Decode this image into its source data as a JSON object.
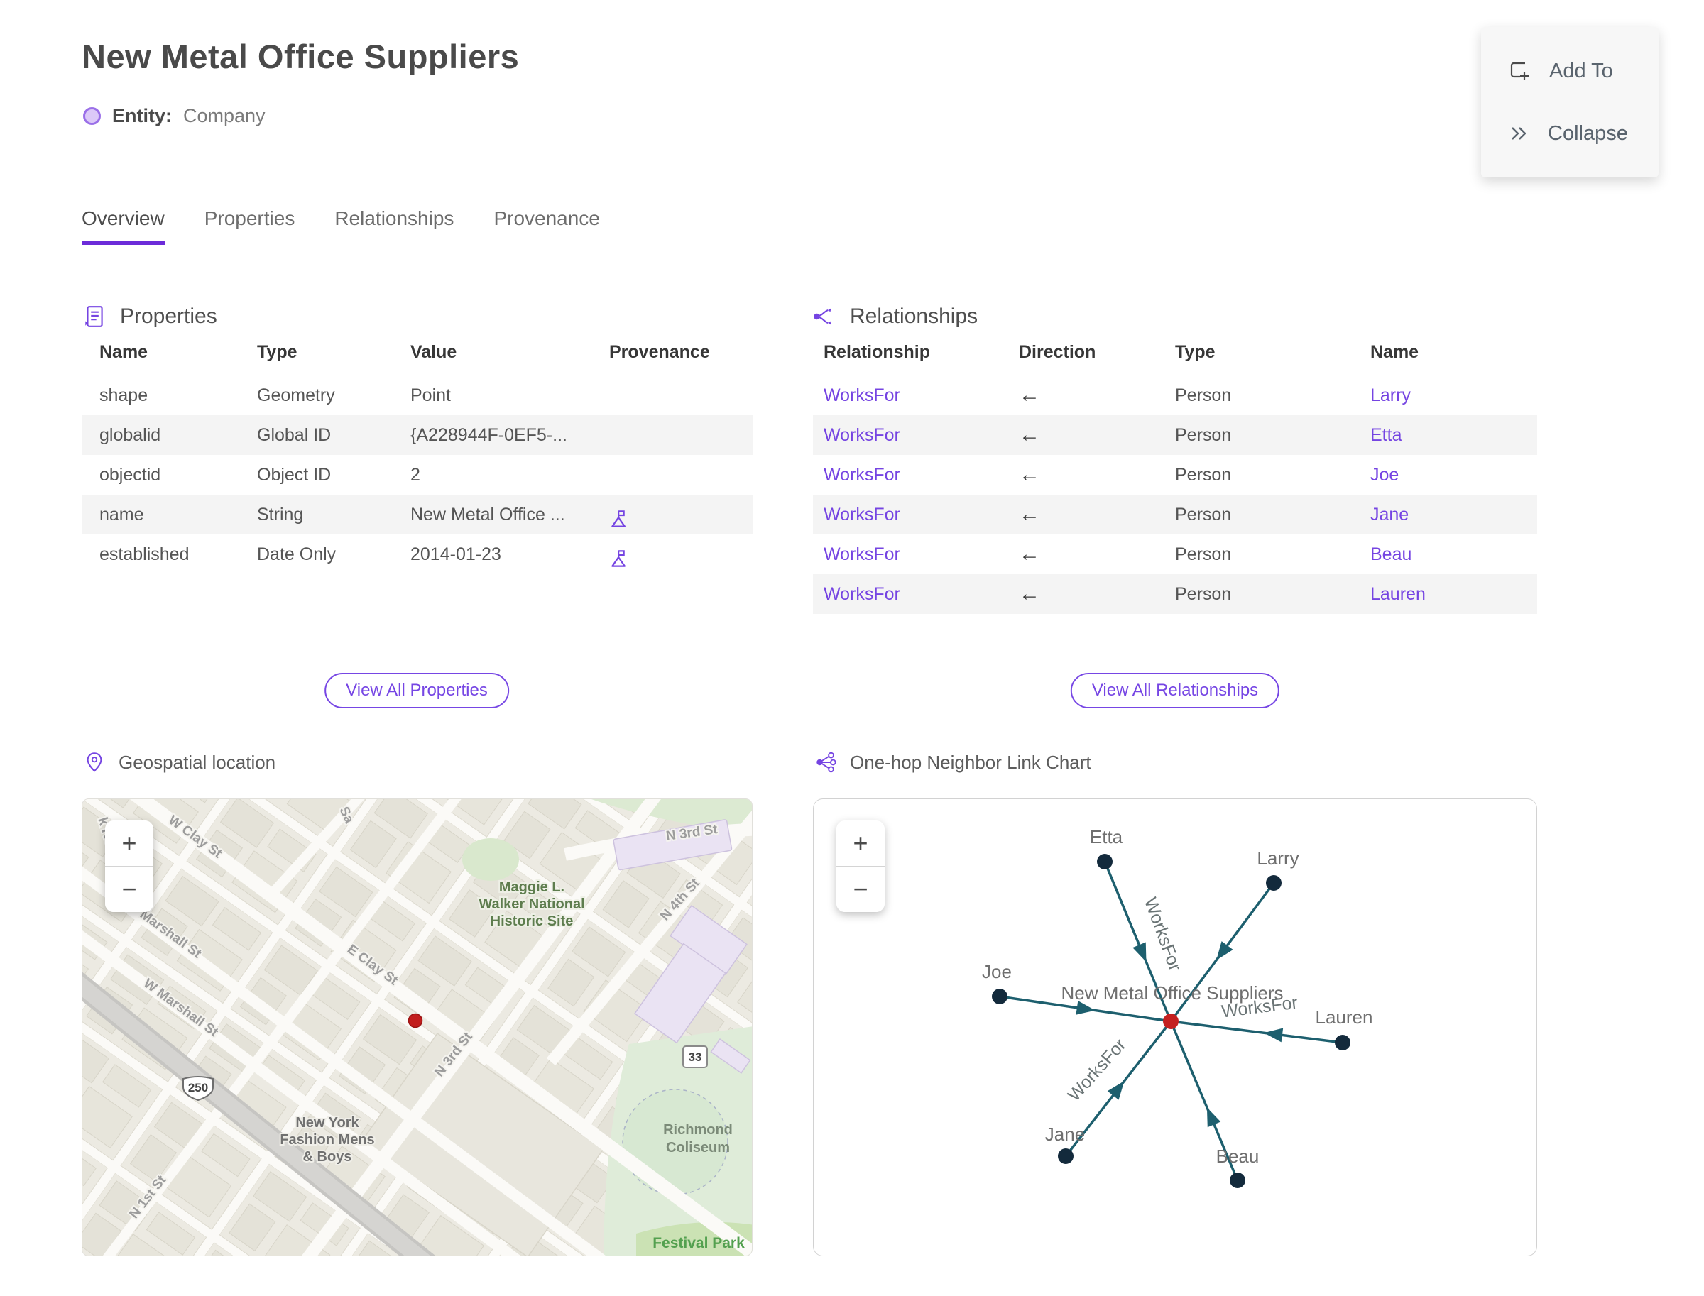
{
  "page": {
    "title": "New Metal Office Suppliers",
    "entity_label": "Entity:",
    "entity_type": "Company"
  },
  "actions": {
    "add_to": "Add To",
    "collapse": "Collapse"
  },
  "tabs": [
    {
      "label": "Overview"
    },
    {
      "label": "Properties"
    },
    {
      "label": "Relationships"
    },
    {
      "label": "Provenance"
    }
  ],
  "properties_section": {
    "title": "Properties",
    "columns": [
      "Name",
      "Type",
      "Value",
      "Provenance"
    ],
    "rows": [
      {
        "name": "shape",
        "type": "Geometry",
        "value": "Point"
      },
      {
        "name": "globalid",
        "type": "Global ID",
        "value": "{A228944F-0EF5-..."
      },
      {
        "name": "objectid",
        "type": "Object ID",
        "value": "2"
      },
      {
        "name": "name",
        "type": "String",
        "value": "New Metal Office ..."
      },
      {
        "name": "established",
        "type": "Date Only",
        "value": "2014-01-23"
      }
    ],
    "view_all_label": "View All Properties"
  },
  "relationships_section": {
    "title": "Relationships",
    "columns": [
      "Relationship",
      "Direction",
      "Type",
      "Name"
    ],
    "rows": [
      {
        "relationship": "WorksFor",
        "direction": "←",
        "type": "Person",
        "name": "Larry"
      },
      {
        "relationship": "WorksFor",
        "direction": "←",
        "type": "Person",
        "name": "Etta"
      },
      {
        "relationship": "WorksFor",
        "direction": "←",
        "type": "Person",
        "name": "Joe"
      },
      {
        "relationship": "WorksFor",
        "direction": "←",
        "type": "Person",
        "name": "Jane"
      },
      {
        "relationship": "WorksFor",
        "direction": "←",
        "type": "Person",
        "name": "Beau"
      },
      {
        "relationship": "WorksFor",
        "direction": "←",
        "type": "Person",
        "name": "Lauren"
      }
    ],
    "view_all_label": "View All Relationships"
  },
  "map_section": {
    "title": "Geospatial location",
    "zoom_in": "+",
    "zoom_out": "−",
    "streets": {
      "k_rd": "k Rd",
      "w_clay": "W Clay St",
      "sa": "Sa",
      "marshall": "Marshall St",
      "w_marshall": "W Marshall St",
      "e_clay": "E Clay St",
      "n_1st": "N 1st St",
      "n_3rd_top": "N 3rd St",
      "n_3rd_mid": "N 3rd St",
      "n_4th": "N 4th St"
    },
    "places": {
      "maggie_1": "Maggie L.",
      "maggie_2": "Walker National",
      "maggie_3": "Historic Site",
      "ny_1": "New York",
      "ny_2": "Fashion Mens",
      "ny_3": "& Boys",
      "richmond_1": "Richmond",
      "richmond_2": "Coliseum",
      "festival": "Festival Park"
    },
    "shields": {
      "us_250": "250",
      "route_33": "33"
    }
  },
  "chart_section": {
    "title": "One-hop Neighbor Link Chart",
    "zoom_in": "+",
    "zoom_out": "−",
    "center_label": "New Metal Office Suppliers",
    "edge_label": "WorksFor",
    "nodes": {
      "etta": "Etta",
      "larry": "Larry",
      "joe": "Joe",
      "lauren": "Lauren",
      "jane": "Jane",
      "beau": "Beau"
    },
    "edges": [
      {
        "from": "Larry",
        "to": "New Metal Office Suppliers",
        "label": "WorksFor"
      },
      {
        "from": "Etta",
        "to": "New Metal Office Suppliers",
        "label": "WorksFor"
      },
      {
        "from": "Joe",
        "to": "New Metal Office Suppliers",
        "label": "WorksFor"
      },
      {
        "from": "Jane",
        "to": "New Metal Office Suppliers",
        "label": "WorksFor"
      },
      {
        "from": "Beau",
        "to": "New Metal Office Suppliers",
        "label": "WorksFor"
      },
      {
        "from": "Lauren",
        "to": "New Metal Office Suppliers",
        "label": "WorksFor"
      }
    ]
  },
  "colors": {
    "accent_purple": "#7544e2",
    "tab_underline": "#6c2bd9",
    "edge_teal": "#1d5f6e",
    "node_navy": "#132a3c",
    "center_red": "#c42020",
    "stripe_gray": "#f4f4f4"
  }
}
